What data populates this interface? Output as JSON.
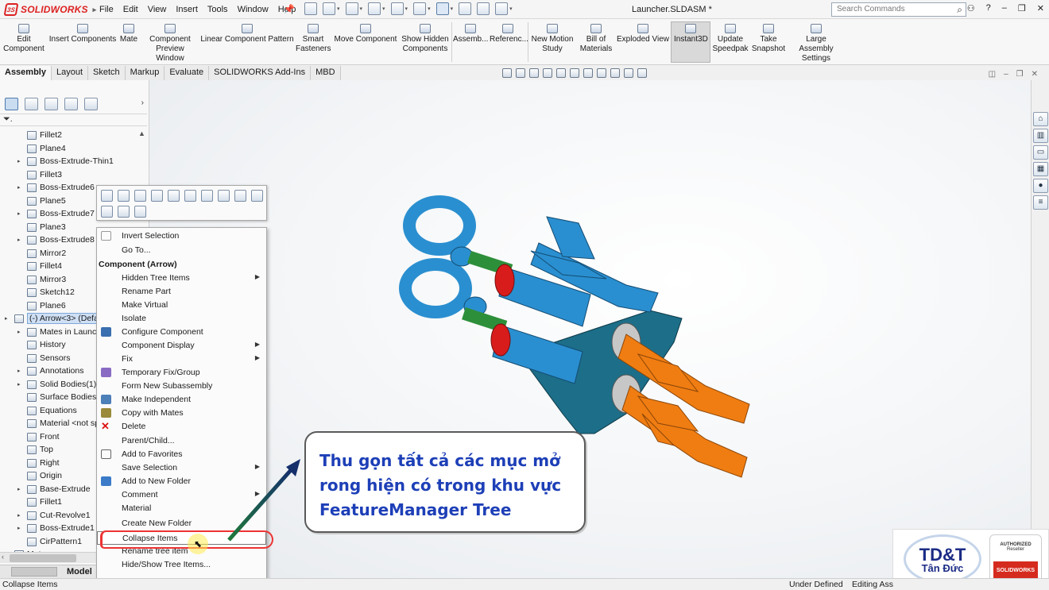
{
  "app": {
    "logo_text": "SOLIDWORKS",
    "doc_title": "Launcher.SLDASM *"
  },
  "menu": [
    "File",
    "Edit",
    "View",
    "Insert",
    "Tools",
    "Window",
    "Help"
  ],
  "search": {
    "placeholder": "Search Commands"
  },
  "commands": {
    "edit_component": "Edit Component",
    "insert_components": "Insert Components",
    "mate": "Mate",
    "preview_window": "Component Preview Window",
    "linear_pattern": "Linear Component Pattern",
    "smart_fasteners": "Smart Fasteners",
    "move_component": "Move Component",
    "show_hidden": "Show Hidden Components",
    "assembly": "Assemb...",
    "reference": "Referenc...",
    "new_motion": "New Motion Study",
    "bill_of_materials": "Bill of Materials",
    "exploded_view": "Exploded View",
    "instant3d": "Instant3D",
    "update_speedpak": "Update Speedpak",
    "take_snapshot": "Take Snapshot",
    "large_assembly": "Large Assembly Settings"
  },
  "tabs": [
    "Assembly",
    "Layout",
    "Sketch",
    "Markup",
    "Evaluate",
    "SOLIDWORKS Add-Ins",
    "MBD"
  ],
  "tree": [
    "Fillet2",
    "Plane4",
    "Boss-Extrude-Thin1",
    "Fillet3",
    "Boss-Extrude6",
    "Plane5",
    "Boss-Extrude7",
    "Plane3",
    "Boss-Extrude8",
    "Mirror2",
    "Fillet4",
    "Mirror3",
    "Sketch12",
    "Plane6",
    "(-) Arrow<3> (Defa",
    "Mates in Launch",
    "History",
    "Sensors",
    "Annotations",
    "Solid Bodies(1)",
    "Surface Bodies",
    "Equations",
    "Material <not sp",
    "Front",
    "Top",
    "Right",
    "Origin",
    "Base-Extrude",
    "Fillet1",
    "Cut-Revolve1",
    "Boss-Extrude1",
    "CirPattern1",
    "Mates"
  ],
  "model_tab": "Model",
  "context_menu": {
    "invert_selection": "Invert Selection",
    "go_to": "Go To...",
    "header": "Component (Arrow)",
    "hidden_tree_items": "Hidden Tree Items",
    "rename_part": "Rename Part",
    "make_virtual": "Make Virtual",
    "isolate": "Isolate",
    "configure_component": "Configure Component",
    "component_display": "Component Display",
    "fix": "Fix",
    "temporary_fix": "Temporary Fix/Group",
    "form_new_subassembly": "Form New Subassembly",
    "make_independent": "Make Independent",
    "copy_with_mates": "Copy with Mates",
    "delete": "Delete",
    "parent_child": "Parent/Child...",
    "add_to_favorites": "Add to Favorites",
    "save_selection": "Save Selection",
    "add_to_new_folder": "Add to New Folder",
    "comment": "Comment",
    "material": "Material",
    "create_new_folder": "Create New Folder",
    "collapse_items": "Collapse Items",
    "rename_tree_item": "Rename tree item",
    "hide_show_tree_items": "Hide/Show Tree Items..."
  },
  "callout": {
    "text": "Thu gọn tất cả các mục mở rong hiện có trong khu vực FeatureManager Tree"
  },
  "statusbar": {
    "left": "Collapse Items",
    "state": "Under Defined",
    "mode": "Editing Ass"
  },
  "brand": {
    "name_top": "TD&T",
    "name_bottom": "Tân Đức",
    "reseller_1": "AUTHORIZED",
    "reseller_2": "Reseller",
    "reseller_logo": "SOLIDWORKS"
  },
  "colors": {
    "model_blue": "#2a8fd0",
    "model_orange": "#f07d12",
    "model_red": "#d81c1c",
    "model_teal": "#1b6a83",
    "callout_text": "#1d3fb7"
  }
}
